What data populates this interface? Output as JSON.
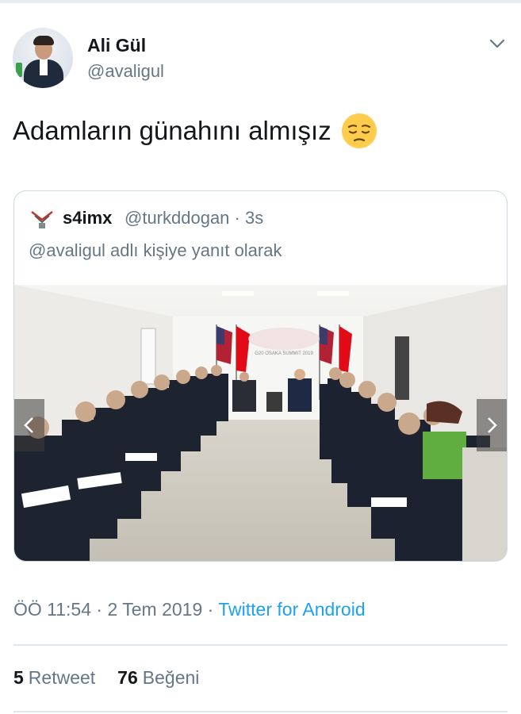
{
  "author": {
    "name": "Ali Gül",
    "handle": "@avaligul"
  },
  "tweet": {
    "text": "Adamların günahını almışız",
    "emoji": "pensive-face-emoji"
  },
  "quoted": {
    "name": "s4imx",
    "meta": "@turkddogan · 3s",
    "reply_text": "@avaligul adlı kişiye yanıt olarak",
    "photo_caption": "G20 OSAKA SUMMIT 2019"
  },
  "meta": {
    "time_date": "ÖÖ 11:54 · 2 Tem 2019 · ",
    "app": "Twitter for Android"
  },
  "stats": {
    "retweets_count": "5",
    "retweets_label": "Retweet",
    "likes_count": "76",
    "likes_label": "Beğeni"
  },
  "colors": {
    "link": "#1da1f2",
    "secondary_text": "#657786",
    "primary_text": "#14171a"
  }
}
